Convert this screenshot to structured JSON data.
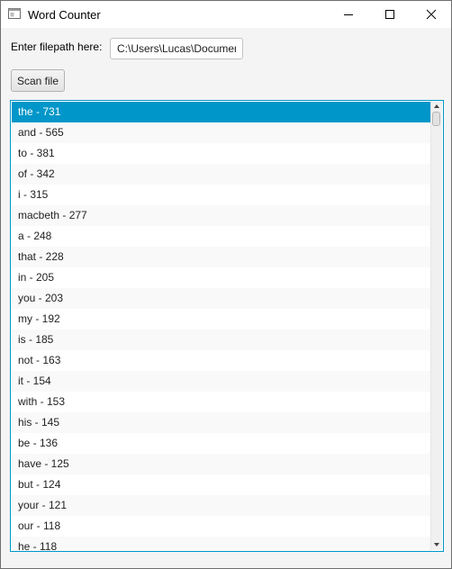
{
  "window": {
    "title": "Word Counter"
  },
  "form": {
    "path_label": "Enter filepath here:",
    "path_value": "C:\\Users\\Lucas\\Documents",
    "scan_label": "Scan file"
  },
  "list": {
    "selected_index": 0,
    "items": [
      "the - 731",
      "and - 565",
      "to - 381",
      "of - 342",
      "i - 315",
      "macbeth - 277",
      "a - 248",
      "that - 228",
      "in - 205",
      "you - 203",
      "my - 192",
      "is - 185",
      "not - 163",
      "it - 154",
      "with - 153",
      "his - 145",
      "be - 136",
      "have - 125",
      "but - 124",
      "your - 121",
      "our - 118",
      "he - 118"
    ]
  },
  "colors": {
    "selection": "#0096c9",
    "list_border": "#0096c9"
  }
}
